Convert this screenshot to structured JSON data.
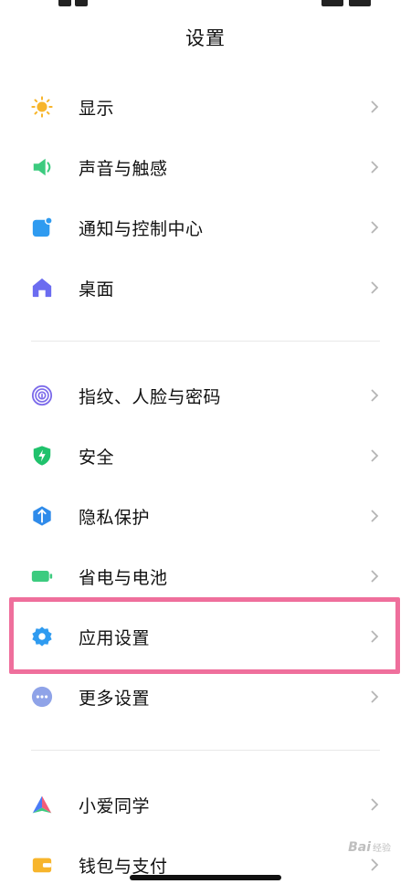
{
  "page": {
    "title": "设置"
  },
  "groups": [
    {
      "items": [
        {
          "label": "显示",
          "icon": "sun-icon",
          "color": "#F7B52C"
        },
        {
          "label": "声音与触感",
          "icon": "speaker-icon",
          "color": "#3CCB7F"
        },
        {
          "label": "通知与控制中心",
          "icon": "notification-icon",
          "color": "#2F9BF0"
        },
        {
          "label": "桌面",
          "icon": "home-icon",
          "color": "#6B6CF0"
        }
      ]
    },
    {
      "items": [
        {
          "label": "指纹、人脸与密码",
          "icon": "fingerprint-icon",
          "color": "#7C6BEA"
        },
        {
          "label": "安全",
          "icon": "shield-icon",
          "color": "#20C26C"
        },
        {
          "label": "隐私保护",
          "icon": "privacy-icon",
          "color": "#2F8BEA"
        },
        {
          "label": "省电与电池",
          "icon": "battery-icon",
          "color": "#3CCB7F"
        },
        {
          "label": "应用设置",
          "icon": "gear-icon",
          "color": "#2F9BF0",
          "highlighted": true
        },
        {
          "label": "更多设置",
          "icon": "more-icon",
          "color": "#8FA3E8"
        }
      ]
    },
    {
      "items": [
        {
          "label": "小爱同学",
          "icon": "xiaoai-icon",
          "color": "#4A7BF7"
        },
        {
          "label": "钱包与支付",
          "icon": "wallet-icon",
          "color": "#F7B52C"
        }
      ]
    }
  ],
  "watermark": {
    "text": "Bai",
    "sub": "经验"
  },
  "highlight_color": "#EF6F9C"
}
